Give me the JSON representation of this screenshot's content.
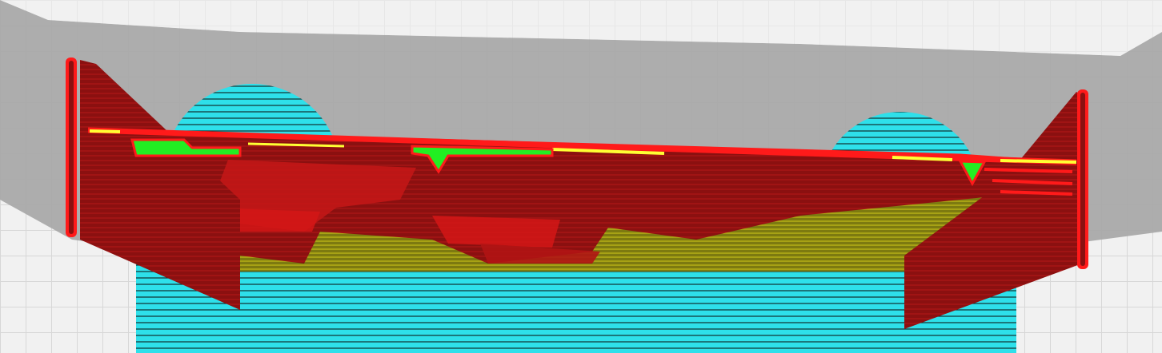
{
  "viewport": {
    "kind": "3d-printer-slicer-layer-preview",
    "background_color": "#f1f1f1",
    "grid_color": "#d7d7d7",
    "model_shadow_color": "#a9a9a9",
    "support_color": "#39e6ef",
    "wall_outer_color": "#ff1a1a",
    "wall_fill_color": "#8b1010",
    "infill_color": "#8f8a12",
    "top_skin_color": "#ffff33",
    "travel_highlight_color": "#22ee22"
  },
  "legend_icons": [
    "build-plate-grid",
    "support-brim",
    "left-fin",
    "right-fin",
    "wing-body"
  ]
}
